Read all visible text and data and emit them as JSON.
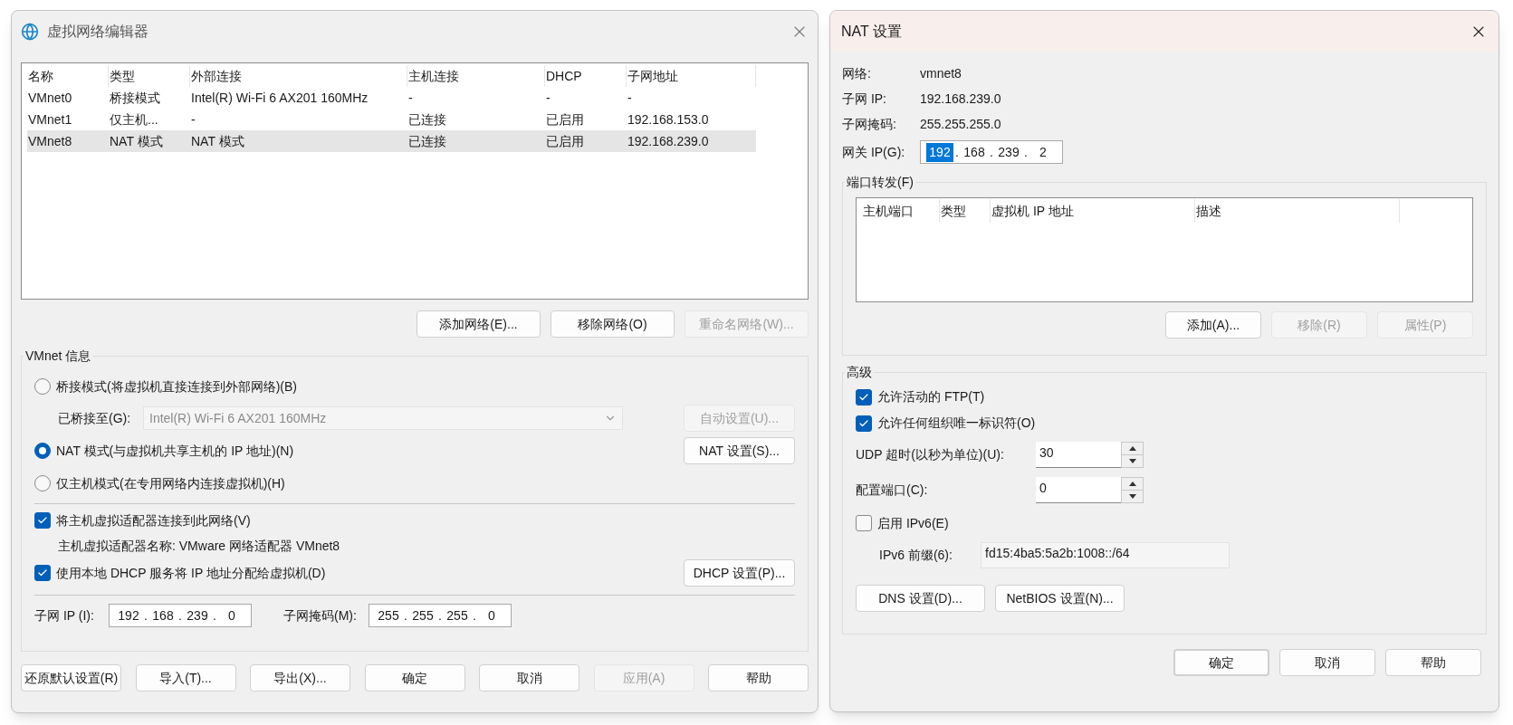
{
  "left": {
    "title": "虚拟网络编辑器",
    "columns": [
      "名称",
      "类型",
      "外部连接",
      "主机连接",
      "DHCP",
      "子网地址"
    ],
    "rows": [
      {
        "cells": [
          "VMnet0",
          "桥接模式",
          "Intel(R) Wi-Fi 6 AX201 160MHz",
          "-",
          "-",
          "-"
        ],
        "selected": false
      },
      {
        "cells": [
          "VMnet1",
          "仅主机...",
          "-",
          "已连接",
          "已启用",
          "192.168.153.0"
        ],
        "selected": false
      },
      {
        "cells": [
          "VMnet8",
          "NAT 模式",
          "NAT 模式",
          "已连接",
          "已启用",
          "192.168.239.0"
        ],
        "selected": true
      }
    ],
    "list_buttons": [
      {
        "label": "添加网络(E)...",
        "disabled": false
      },
      {
        "label": "移除网络(O)",
        "disabled": false
      },
      {
        "label": "重命名网络(W)...",
        "disabled": true
      }
    ],
    "vmnet": {
      "title": "VMnet 信息",
      "modes": [
        {
          "label": "桥接模式(将虚拟机直接连接到外部网络)(B)",
          "selected": false
        },
        {
          "label": "NAT 模式(与虚拟机共享主机的 IP 地址)(N)",
          "selected": true
        },
        {
          "label": "仅主机模式(在专用网络内连接虚拟机)(H)",
          "selected": false
        }
      ],
      "bridged_to": {
        "label": "已桥接至(G):",
        "value": "Intel(R) Wi-Fi 6 AX201 160MHz",
        "disabled": true
      },
      "auto_button": {
        "label": "自动设置(U)...",
        "disabled": true
      },
      "nat_button": {
        "label": "NAT 设置(S)...",
        "disabled": false
      },
      "connect_adapter": {
        "label": "将主机虚拟适配器连接到此网络(V)",
        "checked": true
      },
      "adapter_name": "主机虚拟适配器名称: VMware 网络适配器 VMnet8",
      "dhcp": {
        "label": "使用本地 DHCP 服务将 IP 地址分配给虚拟机(D)",
        "checked": true
      },
      "dhcp_button": {
        "label": "DHCP 设置(P)...",
        "disabled": false
      },
      "subnet_ip": {
        "label": "子网 IP (I):",
        "segments": [
          "192",
          "168",
          "239",
          "0"
        ]
      },
      "subnet_mask": {
        "label": "子网掩码(M):",
        "segments": [
          "255",
          "255",
          "255",
          "0"
        ]
      },
      "separator": "."
    },
    "buttons": [
      {
        "label": "还原默认设置(R)",
        "disabled": false
      },
      {
        "label": "导入(T)...",
        "disabled": false
      },
      {
        "label": "导出(X)...",
        "disabled": false
      },
      {
        "label": "确定",
        "disabled": false
      },
      {
        "label": "取消",
        "disabled": false
      },
      {
        "label": "应用(A)",
        "disabled": true
      },
      {
        "label": "帮助",
        "disabled": false
      }
    ]
  },
  "right": {
    "title": "NAT 设置",
    "info": [
      {
        "label": "网络:",
        "value": "vmnet8"
      },
      {
        "label": "子网 IP:",
        "value": "192.168.239.0"
      },
      {
        "label": "子网掩码:",
        "value": "255.255.255.0"
      }
    ],
    "gateway": {
      "label": "网关 IP(G):",
      "segments": [
        {
          "text": "192",
          "selected": true
        },
        {
          "text": "168",
          "selected": false
        },
        {
          "text": "239",
          "selected": false
        },
        {
          "text": "2",
          "selected": false
        }
      ],
      "separator": "."
    },
    "port_forwarding": {
      "title": "端口转发(F)",
      "columns": [
        "主机端口",
        "类型",
        "虚拟机 IP 地址",
        "描述"
      ],
      "buttons": [
        {
          "label": "添加(A)...",
          "disabled": false
        },
        {
          "label": "移除(R)",
          "disabled": true
        },
        {
          "label": "属性(P)",
          "disabled": true
        }
      ]
    },
    "advanced": {
      "title": "高级",
      "options": [
        {
          "label": "允许活动的 FTP(T)",
          "checked": true
        },
        {
          "label": "允许任何组织唯一标识符(O)",
          "checked": true
        }
      ],
      "udp_timeout": {
        "label": "UDP 超时(以秒为单位)(U):",
        "value": "30"
      },
      "config_port": {
        "label": "配置端口(C):",
        "value": "0"
      },
      "ipv6": {
        "label": "启用 IPv6(E)",
        "checked": false
      },
      "ipv6_prefix": {
        "label": "IPv6 前缀(6):",
        "value": "fd15:4ba5:5a2b:1008::/64",
        "disabled": true
      },
      "buttons": [
        {
          "label": "DNS 设置(D)..."
        },
        {
          "label": "NetBIOS 设置(N)..."
        }
      ]
    },
    "buttons": [
      {
        "label": "确定",
        "default": true
      },
      {
        "label": "取消",
        "default": false
      },
      {
        "label": "帮助",
        "default": false
      }
    ]
  }
}
